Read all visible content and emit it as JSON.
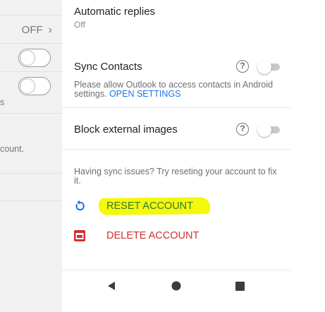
{
  "left_panel": {
    "value": "OFF",
    "chevron": "›",
    "fragment_1": "s",
    "fragment_2": "count."
  },
  "settings": {
    "automatic_replies": {
      "title": "Automatic replies",
      "value": "Off"
    },
    "sync_contacts": {
      "title": "Sync Contacts",
      "help": "?",
      "description": "Please allow Outlook to access contacts in Android settings.",
      "link": "OPEN SETTINGS"
    },
    "block_images": {
      "title": "Block external images",
      "help": "?"
    },
    "sync_issues": "Having sync issues? Try reseting your account to fix it.",
    "reset_account": {
      "label": "RESET ACCOUNT",
      "icon": "reset-icon"
    },
    "delete_account": {
      "label": "DELETE ACCOUNT",
      "icon": "delete-icon"
    }
  },
  "colors": {
    "highlight": "#f4f80d",
    "reset": "#2e7a32",
    "reset_icon": "#1a73e8",
    "delete": "#d32f2f",
    "link": "#1a73e8"
  },
  "navbar": {
    "back_icon": "back-icon",
    "home_icon": "home-icon",
    "recents_icon": "recents-icon"
  }
}
